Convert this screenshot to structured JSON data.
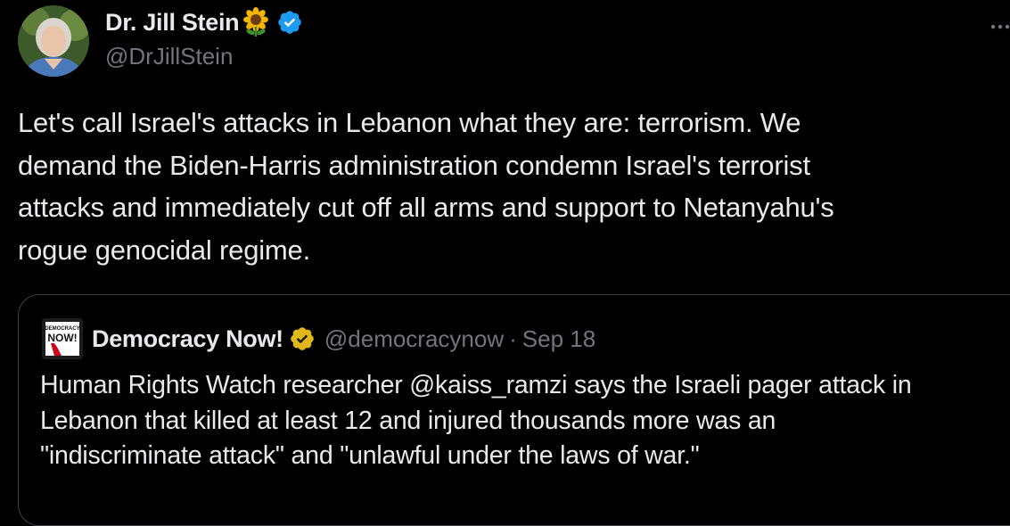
{
  "author": {
    "display_name": "Dr. Jill Stein",
    "handle": "@DrJillStein",
    "name_emoji": "sunflower-icon",
    "verified_color": "#1d9bf0"
  },
  "tweet": {
    "text": "Let's call Israel's attacks in Lebanon what they are: terrorism. We\ndemand the Biden-Harris administration condemn Israel's terrorist\nattacks and immediately cut off all arms and support to Netanyahu's\nrogue genocidal regime."
  },
  "quoted_tweet": {
    "avatar_label_top": "DEMOCRACY",
    "avatar_label_bottom": "NOW!",
    "display_name": "Democracy Now!",
    "badge_color": "#e2b719",
    "handle": "@democracynow",
    "separator": "·",
    "date": "Sep 18",
    "text": "Human Rights Watch researcher @kaiss_ramzi says the Israeli pager attack in\nLebanon that killed at least 12 and injured thousands more was an\n\"indiscriminate attack\" and \"unlawful under the laws of war.\""
  },
  "colors": {
    "background": "#000000",
    "text_primary": "#e7e9ea",
    "text_secondary": "#71767b",
    "border": "#3c4043"
  }
}
